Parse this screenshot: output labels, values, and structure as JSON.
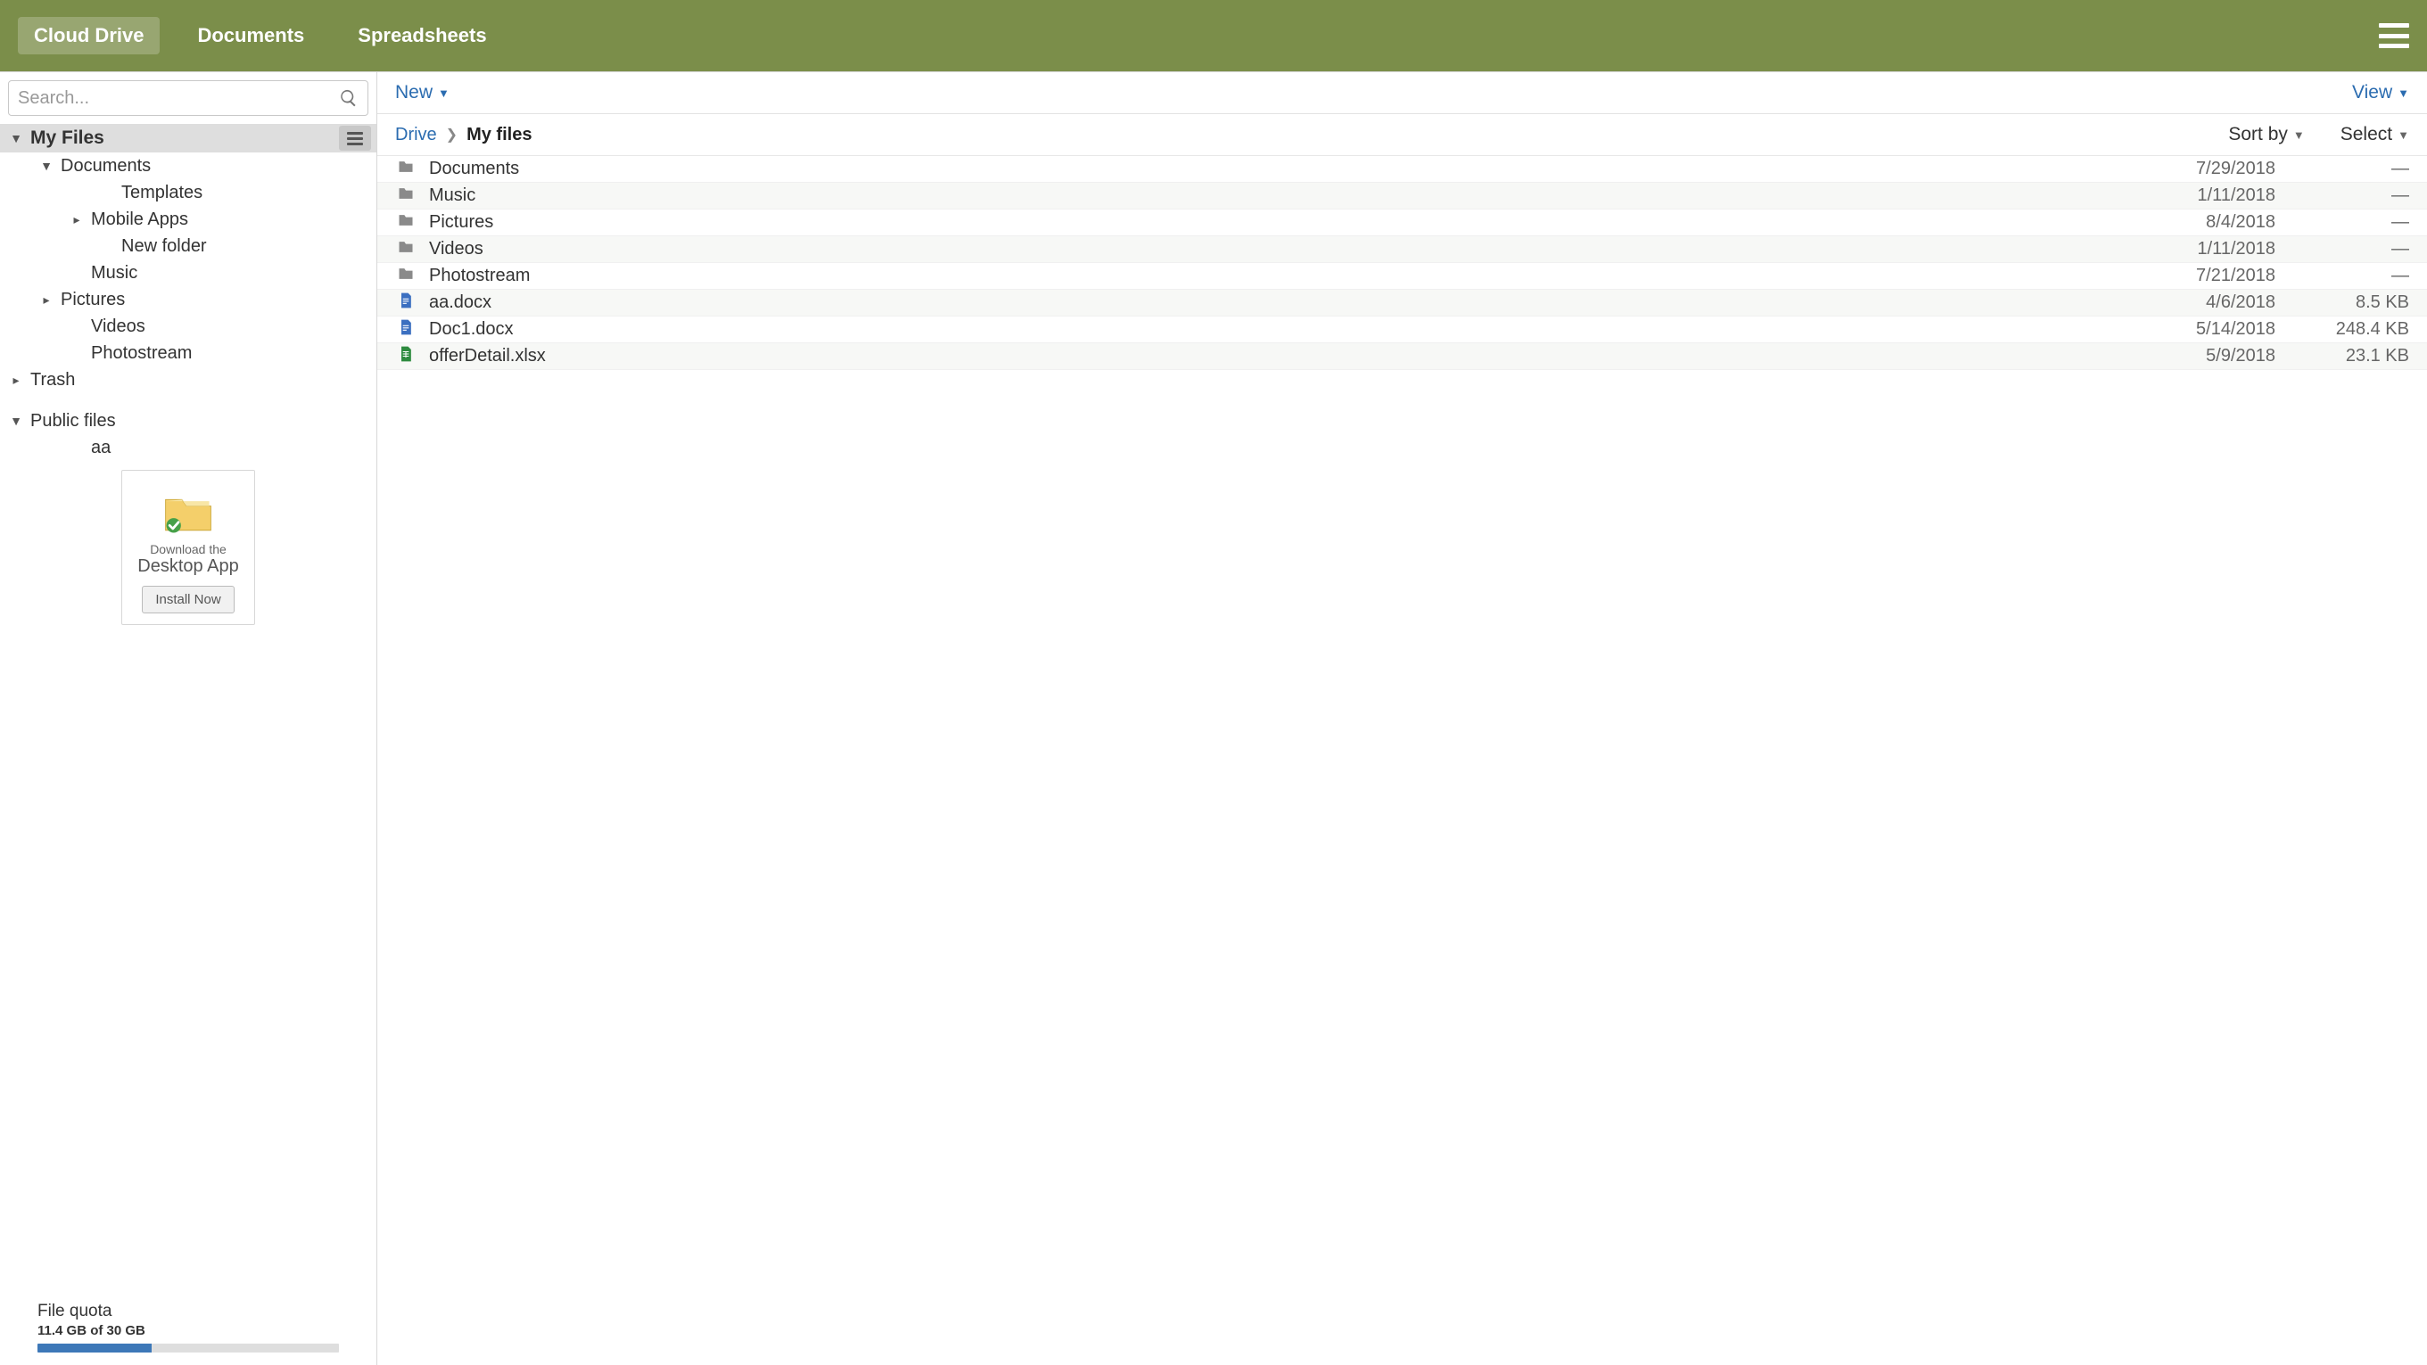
{
  "topbar": {
    "tabs": [
      {
        "label": "Cloud Drive",
        "active": true
      },
      {
        "label": "Documents",
        "active": false
      },
      {
        "label": "Spreadsheets",
        "active": false
      }
    ]
  },
  "search": {
    "placeholder": "Search..."
  },
  "tree": {
    "my_files_label": "My Files",
    "trash_label": "Trash",
    "public_label": "Public files",
    "documents": "Documents",
    "templates": "Templates",
    "mobile_apps": "Mobile Apps",
    "new_folder": "New folder",
    "music": "Music",
    "pictures": "Pictures",
    "videos": "Videos",
    "photostream": "Photostream",
    "public_aa": "aa"
  },
  "promo": {
    "line1": "Download the",
    "line2": "Desktop App",
    "button": "Install Now"
  },
  "quota": {
    "title": "File quota",
    "subtitle": "11.4 GB of 30 GB",
    "percent": 38
  },
  "toolbar": {
    "new": "New",
    "view": "View"
  },
  "breadcrumb": {
    "root": "Drive",
    "current": "My files",
    "sort_by": "Sort by",
    "select": "Select"
  },
  "files": [
    {
      "icon": "folder",
      "name": "Documents",
      "date": "7/29/2018",
      "size": "—"
    },
    {
      "icon": "folder",
      "name": "Music",
      "date": "1/11/2018",
      "size": "—"
    },
    {
      "icon": "folder",
      "name": "Pictures",
      "date": "8/4/2018",
      "size": "—"
    },
    {
      "icon": "folder",
      "name": "Videos",
      "date": "1/11/2018",
      "size": "—"
    },
    {
      "icon": "folder",
      "name": "Photostream",
      "date": "7/21/2018",
      "size": "—"
    },
    {
      "icon": "doc",
      "name": "aa.docx",
      "date": "4/6/2018",
      "size": "8.5 KB"
    },
    {
      "icon": "doc",
      "name": "Doc1.docx",
      "date": "5/14/2018",
      "size": "248.4 KB"
    },
    {
      "icon": "sheet",
      "name": "offerDetail.xlsx",
      "date": "5/9/2018",
      "size": "23.1 KB"
    }
  ]
}
